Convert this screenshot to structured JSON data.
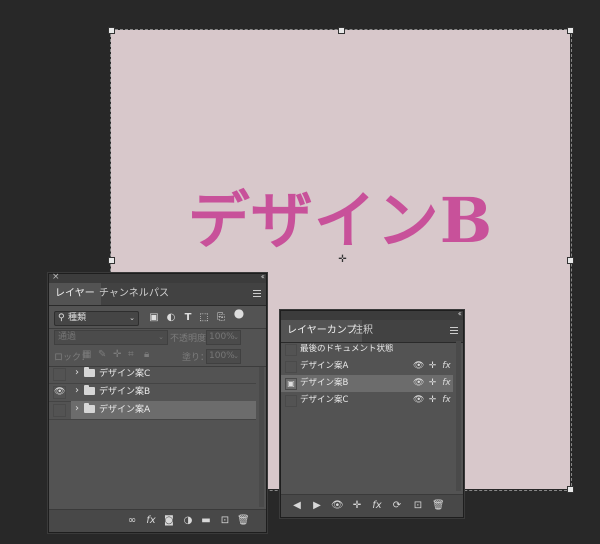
{
  "canvas": {
    "text": "デザインB",
    "text_color": "#c8519a",
    "background": "#d8c8cb"
  },
  "layers_panel": {
    "close_icon": "×",
    "collapse_icon": "‹‹",
    "tabs": [
      {
        "label": "レイヤー",
        "active": true
      },
      {
        "label": "チャンネル",
        "active": false
      },
      {
        "label": "パス",
        "active": false
      }
    ],
    "filter_kind": "種類",
    "blend_mode": "通過",
    "opacity_label": "不透明度：",
    "opacity_value": "100%",
    "lock_label": "ロック：",
    "fill_label": "塗り：",
    "fill_value": "100%",
    "layers": [
      {
        "name": "デザイン案C",
        "visible": false,
        "selected": false
      },
      {
        "name": "デザイン案B",
        "visible": true,
        "selected": false
      },
      {
        "name": "デザイン案A",
        "visible": false,
        "selected": true
      }
    ]
  },
  "comps_panel": {
    "tabs": [
      {
        "label": "レイヤーカンプ",
        "active": true
      },
      {
        "label": "注釈",
        "active": false
      }
    ],
    "last_state": "最後のドキュメント状態",
    "comps": [
      {
        "name": "デザイン案A",
        "applied": false
      },
      {
        "name": "デザイン案B",
        "applied": true
      },
      {
        "name": "デザイン案C",
        "applied": false
      }
    ]
  }
}
